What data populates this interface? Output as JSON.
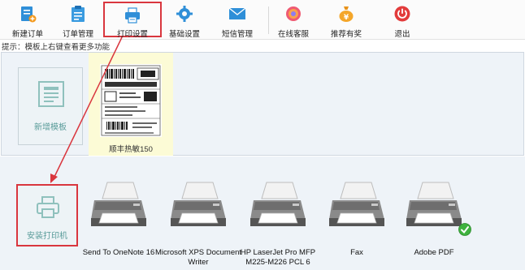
{
  "toolbar": {
    "buttons": [
      {
        "label": "新建订单",
        "icon": "new-order-icon"
      },
      {
        "label": "订单管理",
        "icon": "order-list-icon"
      },
      {
        "label": "打印设置",
        "icon": "printer-icon",
        "active": true
      },
      {
        "label": "基础设置",
        "icon": "gear-icon"
      },
      {
        "label": "短信管理",
        "icon": "envelope-icon"
      },
      {
        "label": "在线客服",
        "icon": "customer-service-icon"
      },
      {
        "label": "推荐有奖",
        "icon": "money-bag-icon"
      },
      {
        "label": "退出",
        "icon": "power-icon"
      }
    ]
  },
  "hint": "提示：模板上右键查看更多功能",
  "templates": {
    "add_label": "新增模板",
    "items": [
      {
        "label": "顺丰热敏150"
      }
    ]
  },
  "printers": {
    "install_label": "安装打印机",
    "items": [
      {
        "name": "Send To OneNote 16"
      },
      {
        "name": "Microsoft XPS Document Writer"
      },
      {
        "name": "HP LaserJet Pro MFP M225-M226 PCL 6"
      },
      {
        "name": "Fax"
      },
      {
        "name": "Adobe PDF",
        "default": true
      }
    ]
  },
  "colors": {
    "highlight": "#d9363e",
    "teal_text": "#5a9c9a",
    "panel_bg": "#eef3f8",
    "template_bg": "#fcfbd6"
  }
}
